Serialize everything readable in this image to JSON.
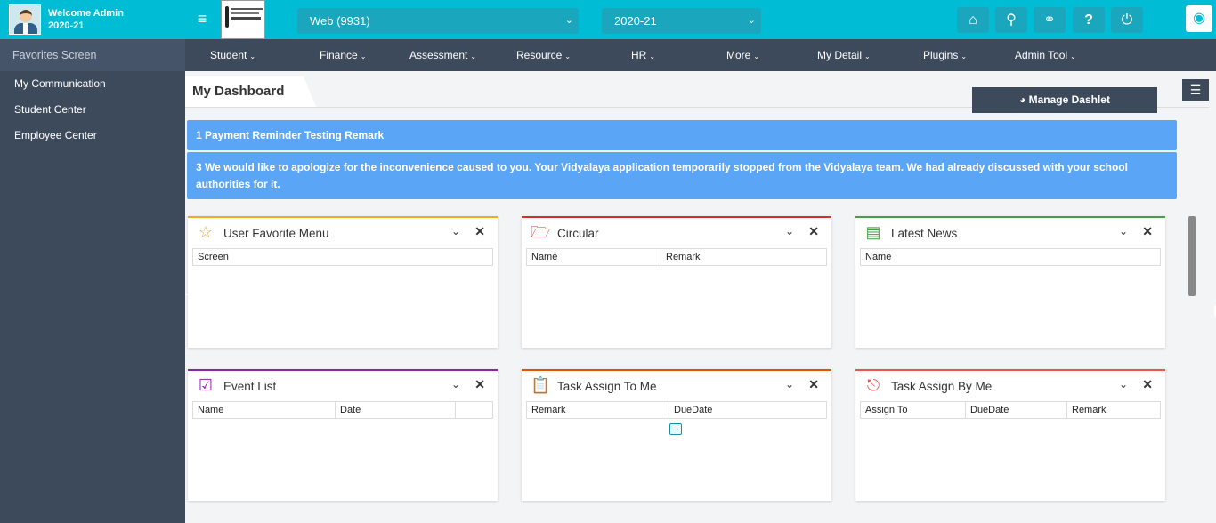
{
  "header": {
    "welcome": "Welcome Admin",
    "session": "2020-21",
    "selects": {
      "web": "Web (9931)",
      "year": "2020-21"
    },
    "toolbar_icons": [
      "home-icon",
      "search-icon",
      "link-icon",
      "help-icon",
      "power-icon",
      "paint-bucket-icon"
    ]
  },
  "nav": {
    "items": [
      "Student",
      "Finance",
      "Assessment",
      "Resource",
      "HR",
      "More",
      "My Detail",
      "Plugins",
      "Admin Tool"
    ]
  },
  "sidebar": {
    "heading": "Favorites Screen",
    "items": [
      "My Communication",
      "Student Center",
      "Employee Center"
    ]
  },
  "dashboard": {
    "title": "My Dashboard",
    "manage_label": "Manage Dashlet",
    "notices": [
      "1 Payment Reminder Testing Remark",
      "3 We would like to apologize for the inconvenience caused to you. Your Vidyalaya application temporarily stopped from the Vidyalaya team. We had already discussed with your school authorities for it."
    ],
    "dashlets": [
      {
        "title": "User Favorite Menu",
        "accent": "#f5a623",
        "icon": "star-icon",
        "columns": [
          "Screen"
        ]
      },
      {
        "title": "Circular",
        "accent": "#d32f2f",
        "icon": "folder-icon",
        "columns": [
          "Name",
          "Remark"
        ]
      },
      {
        "title": "Latest News",
        "accent": "#43a047",
        "icon": "newspaper-icon",
        "columns": [
          "Name"
        ]
      },
      {
        "title": "Event List",
        "accent": "#8e24aa",
        "icon": "calendar-check-icon",
        "columns": [
          "Name",
          "Date",
          ""
        ]
      },
      {
        "title": "Task Assign To Me",
        "accent": "#e65100",
        "icon": "clipboard-icon",
        "columns": [
          "Remark",
          "DueDate"
        ]
      },
      {
        "title": "Task Assign By Me",
        "accent": "#ef5350",
        "icon": "task-out-icon",
        "columns": [
          "Assign To",
          "DueDate",
          "Remark"
        ]
      }
    ]
  },
  "colors": {
    "topbar": "#00bcd4",
    "nav": "#3d4a5c",
    "notice": "#5aa5f6"
  }
}
